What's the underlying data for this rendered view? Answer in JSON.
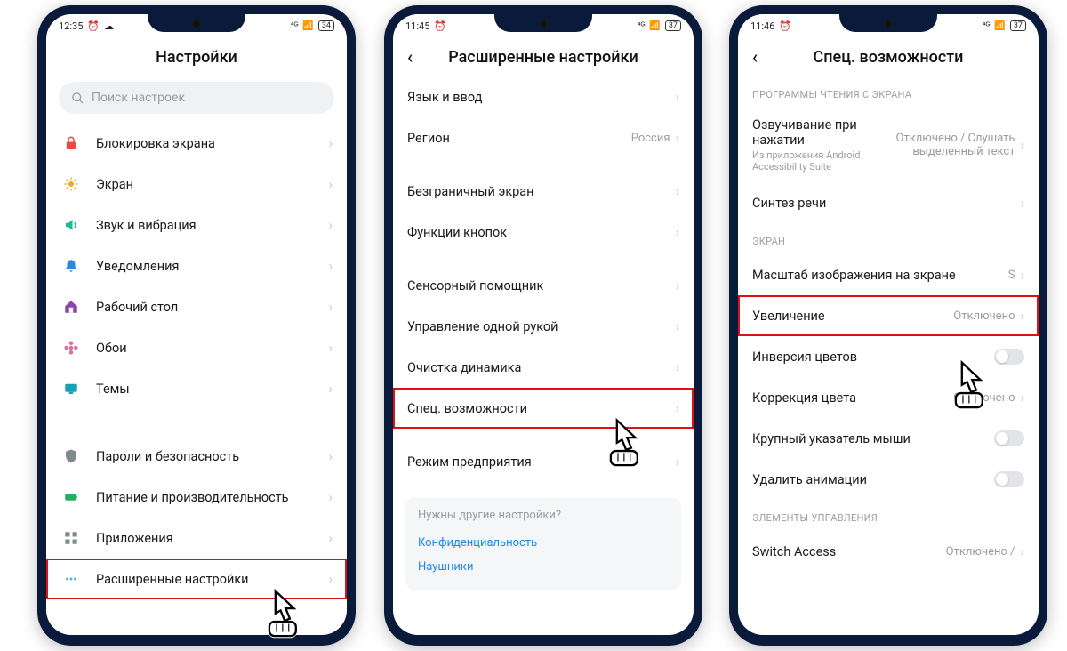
{
  "phones": {
    "p1": {
      "status": {
        "time": "12:35",
        "alarm": "⏰",
        "cloud": "☁",
        "signal": "⁴ᴳ",
        "net": "📶",
        "battery": "34"
      },
      "title": "Настройки",
      "search_placeholder": "Поиск настроек",
      "group1": [
        {
          "icon": "lock",
          "color": "#e74c3c",
          "label": "Блокировка экрана"
        },
        {
          "icon": "sun",
          "color": "#f5a623",
          "label": "Экран"
        },
        {
          "icon": "sound",
          "color": "#1abc9c",
          "label": "Звук и вибрация"
        },
        {
          "icon": "bell",
          "color": "#2e86de",
          "label": "Уведомления"
        },
        {
          "icon": "home",
          "color": "#8e44ad",
          "label": "Рабочий стол"
        },
        {
          "icon": "flower",
          "color": "#e06aa3",
          "label": "Обои"
        },
        {
          "icon": "theme",
          "color": "#17a2b8",
          "label": "Темы"
        }
      ],
      "group2": [
        {
          "icon": "shield",
          "color": "#7f8c8d",
          "label": "Пароли и безопасность"
        },
        {
          "icon": "battery",
          "color": "#27ae60",
          "label": "Питание и производительность"
        },
        {
          "icon": "apps",
          "color": "#7f8c8d",
          "label": "Приложения"
        },
        {
          "icon": "dots",
          "color": "#5dade2",
          "label": "Расширенные настройки",
          "highlight": true
        }
      ]
    },
    "p2": {
      "status": {
        "time": "11:45",
        "alarm": "⏰",
        "signal": "⁴ᴳ",
        "net": "📶",
        "battery": "37"
      },
      "title": "Расширенные настройки",
      "top_cut": "Язык и ввод",
      "items": [
        {
          "label": "Регион",
          "value": "Россия"
        },
        {
          "gap": true
        },
        {
          "label": "Безграничный экран"
        },
        {
          "label": "Функции кнопок"
        },
        {
          "gap": true
        },
        {
          "label": "Сенсорный помощник"
        },
        {
          "label": "Управление одной рукой"
        },
        {
          "label": "Очистка динамика"
        },
        {
          "label": "Спец. возможности",
          "highlight": true
        },
        {
          "gap": true
        },
        {
          "label": "Режим предприятия"
        }
      ],
      "footer": {
        "prompt": "Нужны другие настройки?",
        "links": [
          "Конфиденциальность",
          "Наушники"
        ]
      }
    },
    "p3": {
      "status": {
        "time": "11:46",
        "alarm": "⏰",
        "signal": "⁴ᴳ",
        "net": "📶",
        "battery": "37"
      },
      "title": "Спец. возможности",
      "sections": [
        {
          "header": "ПРОГРАММЫ ЧТЕНИЯ С ЭКРАНА",
          "items": [
            {
              "label": "Озвучивание при нажатии",
              "sub": "Из приложения Android Accessibility Suite",
              "value": "Отключено / Слушать выделенный текст"
            },
            {
              "label": "Синтез речи"
            }
          ]
        },
        {
          "header": "ЭКРАН",
          "items": [
            {
              "label": "Масштаб изображения на экране",
              "value": "S"
            },
            {
              "label": "Увеличение",
              "value": "Отключено",
              "highlight": true
            },
            {
              "label": "Инверсия цветов",
              "toggle": true
            },
            {
              "label": "Коррекция цвета",
              "value": "Отключено"
            },
            {
              "label": "Крупный указатель мыши",
              "toggle": true
            },
            {
              "label": "Удалить анимации",
              "toggle": true
            }
          ]
        },
        {
          "header": "ЭЛЕМЕНТЫ УПРАВЛЕНИЯ",
          "items": [
            {
              "label": "Switch Access",
              "value": "Отключено /"
            }
          ]
        }
      ]
    }
  }
}
